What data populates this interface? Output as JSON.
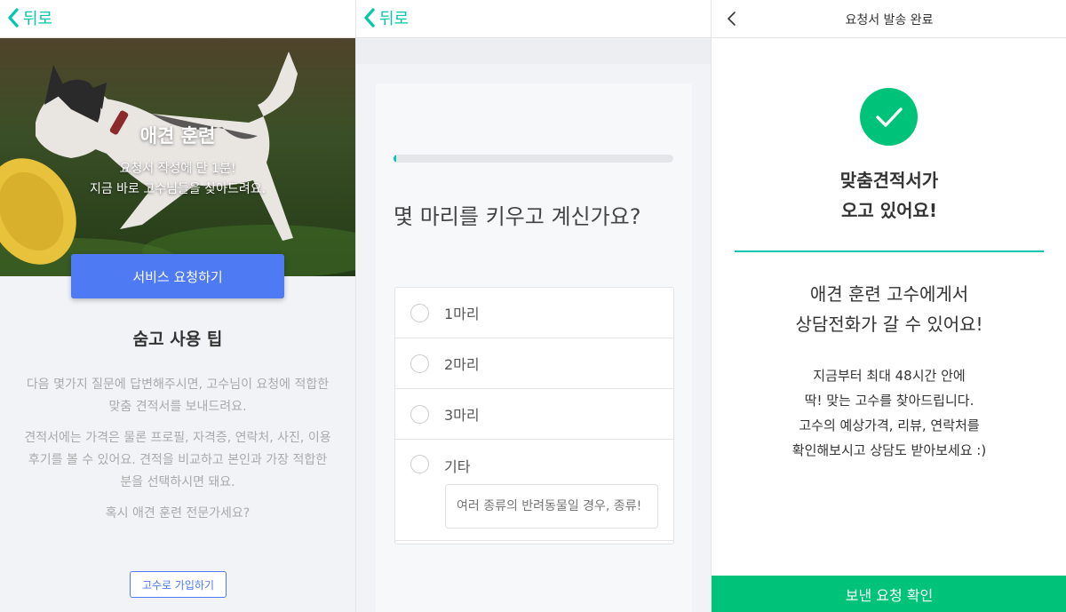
{
  "panel1": {
    "back_label": "뒤로",
    "hero": {
      "title": "애견 훈련",
      "subtitle_line1": "요청서 작성에 단 1분!",
      "subtitle_line2": "지금 바로 고수님들을 찾아드려요."
    },
    "request_button": "서비스 요청하기",
    "tips_title": "숨고 사용 팁",
    "tips": [
      "다음 몇가지 질문에 답변해주시면, 고수님이 요청에 적합한",
      "맞춤 견적서를 보내드려요.",
      "견적서에는 가격은 물론 프로필, 자격증, 연락처, 사진, 이용",
      "후기를 볼 수 있어요. 견적을 비교하고 본인과 가장 적합한",
      "분을 선택하시면 돼요.",
      "혹시 애견 훈련 전문가세요?"
    ],
    "join_button": "고수로 가입하기"
  },
  "panel2": {
    "back_label": "뒤로",
    "progress_fraction": 0.01,
    "question": "몇 마리를 키우고 계신가요?",
    "options": [
      "1마리",
      "2마리",
      "3마리",
      "기타"
    ],
    "etc_placeholder": "여러 종류의 반려동물일 경우, 종류!"
  },
  "panel3": {
    "title": "요청서 발송 완료",
    "done_line1": "맞춤견적서가",
    "done_line2": "오고 있어요!",
    "consult_line1": "애견 훈련 고수에게서",
    "consult_line2": "상담전화가 갈 수 있어요!",
    "desc_lines": [
      "지금부터 최대 48시간 안에",
      "딱! 맞는 고수를 찾아드립니다.",
      "고수의 예상가격, 리뷰, 연락처를",
      "확인해보시고 상담도 받아보세요 :)"
    ],
    "confirm_button": "보낸 요청 확인"
  },
  "colors": {
    "accent_teal": "#00c7ae",
    "primary_blue": "#4e7bf4",
    "success_green": "#00c37a"
  },
  "icons": {
    "back": "chevron-left-icon",
    "check": "check-icon",
    "radio": "radio-empty-icon"
  }
}
